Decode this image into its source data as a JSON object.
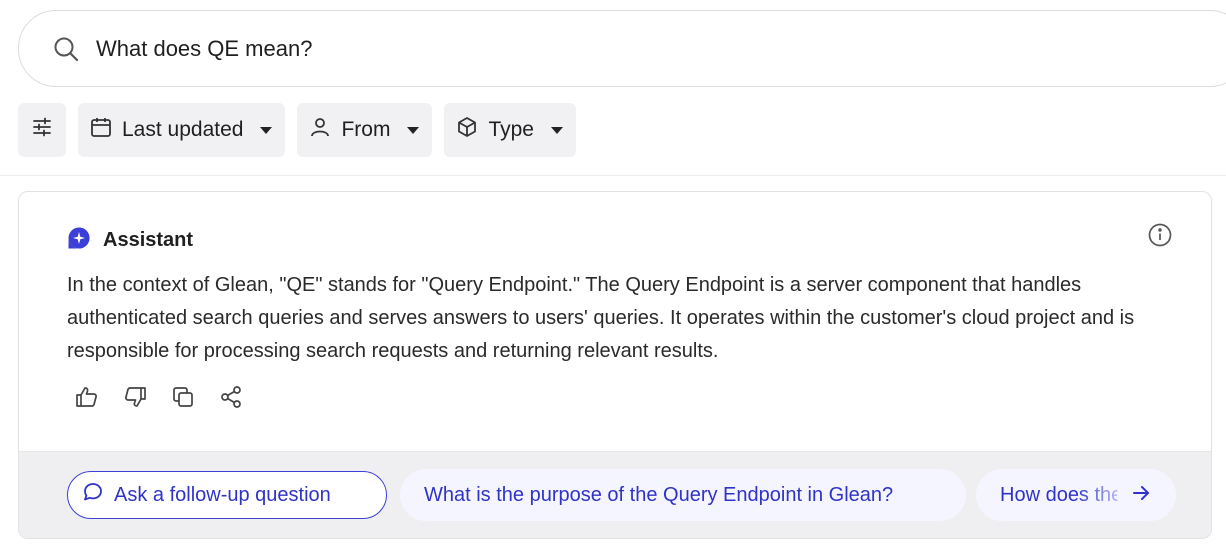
{
  "search": {
    "query": "What does QE mean?"
  },
  "filters": [
    {
      "label": "Last updated",
      "icon": "calendar-icon"
    },
    {
      "label": "From",
      "icon": "person-icon"
    },
    {
      "label": "Type",
      "icon": "cube-icon"
    }
  ],
  "assistant": {
    "label": "Assistant",
    "answer": "In the context of Glean, \"QE\" stands for \"Query Endpoint.\" The Query Endpoint is a server component that handles authenticated search queries and serves answers to users' queries. It operates within the customer's cloud project and is responsible for processing search requests and returning relevant results."
  },
  "footer": {
    "followup_label": "Ask a follow-up question",
    "suggestions": [
      "What is the purpose of the Query Endpoint in Glean?",
      "How does the"
    ]
  },
  "colors": {
    "accent": "#3b3fd8",
    "chip_bg": "#f1f1f3",
    "footer_bg": "#efeff1",
    "suggestion_bg": "#f5f5ff"
  }
}
